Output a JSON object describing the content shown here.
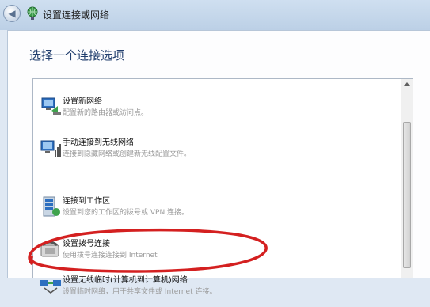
{
  "window": {
    "title": "设置连接或网络",
    "back_icon": "back-arrow-icon",
    "title_icon": "network-globe-icon"
  },
  "main": {
    "heading": "选择一个连接选项",
    "options": [
      {
        "title": "设置新网络",
        "description": "配置新的路由器或访问点。",
        "icon": "new-network-icon"
      },
      {
        "title": "手动连接到无线网络",
        "description": "连接到隐藏网络或创建新无线配置文件。",
        "icon": "wireless-manual-icon"
      },
      {
        "title": "连接到工作区",
        "description": "设置到您的工作区的拨号或 VPN 连接。",
        "icon": "workplace-icon"
      },
      {
        "title": "设置拨号连接",
        "description": "使用拨号连接连接到 Internet",
        "icon": "dialup-phone-icon"
      },
      {
        "title": "设置无线临时(计算机到计算机)网络",
        "description": "设置临时网络，用于共享文件或 Internet 连接。",
        "icon": "adhoc-network-icon"
      }
    ]
  },
  "annotation": {
    "color": "#d42020"
  }
}
